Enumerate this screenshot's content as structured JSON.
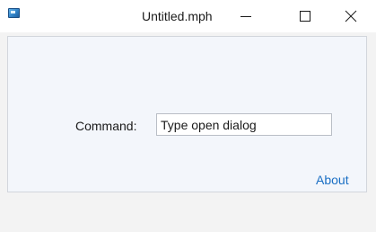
{
  "window": {
    "title": "Untitled.mph"
  },
  "icons": {
    "app": "app-icon",
    "minimize": "minimize-icon",
    "maximize": "maximize-icon",
    "close": "close-icon"
  },
  "form": {
    "command_label": "Command:",
    "command_value": "Type open dialog"
  },
  "links": {
    "about": "About"
  },
  "colors": {
    "link": "#1a6fc4",
    "content_bg": "#f3f6fb",
    "window_bg": "#f3f3f3"
  }
}
